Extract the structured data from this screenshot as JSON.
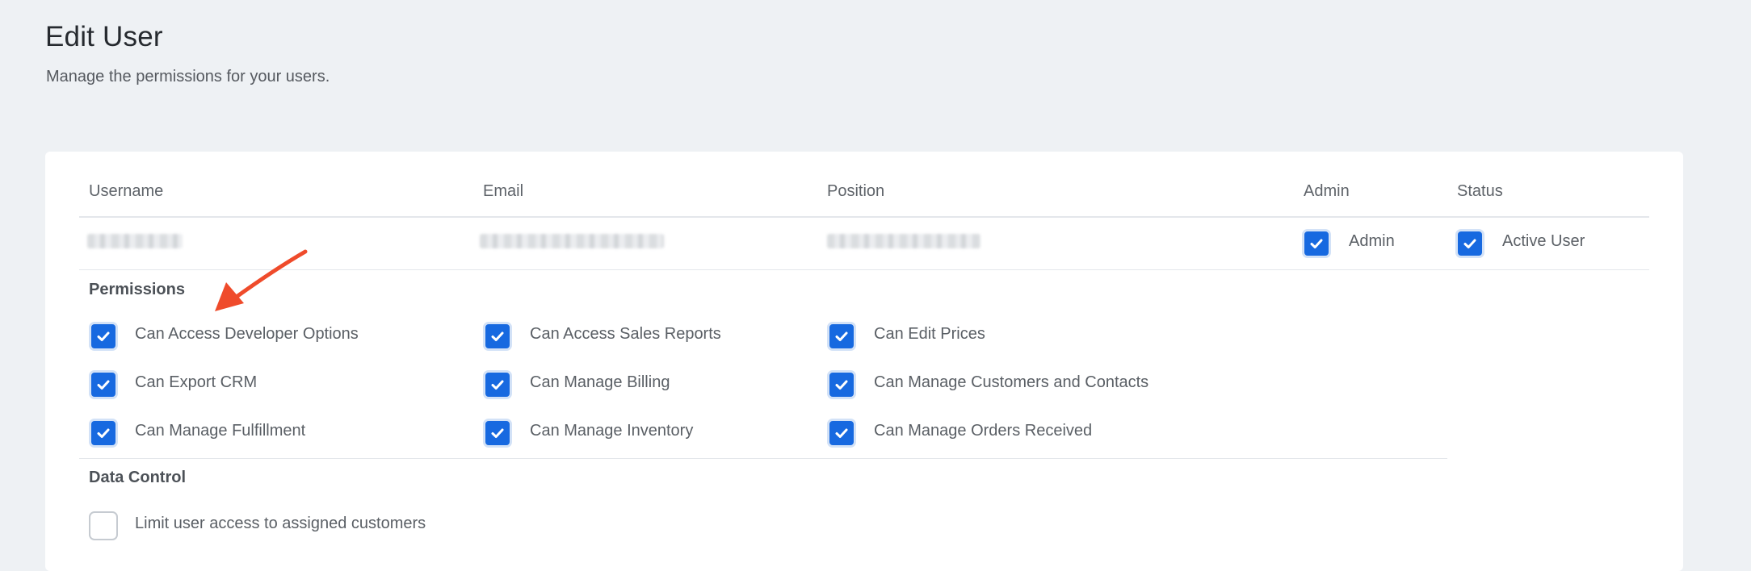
{
  "page": {
    "title": "Edit User",
    "subtitle": "Manage the permissions for your users."
  },
  "table": {
    "headers": {
      "username": "Username",
      "email": "Email",
      "position": "Position",
      "admin": "Admin",
      "status": "Status"
    },
    "row": {
      "admin_checked": true,
      "admin_label": "Admin",
      "status_checked": true,
      "status_label": "Active User"
    }
  },
  "permissions": {
    "title": "Permissions",
    "items": [
      {
        "label": "Can Access Developer Options",
        "checked": true
      },
      {
        "label": "Can Access Sales Reports",
        "checked": true
      },
      {
        "label": "Can Edit Prices",
        "checked": true
      },
      {
        "label": "Can Export CRM",
        "checked": true
      },
      {
        "label": "Can Manage Billing",
        "checked": true
      },
      {
        "label": "Can Manage Customers and Contacts",
        "checked": true
      },
      {
        "label": "Can Manage Fulfillment",
        "checked": true
      },
      {
        "label": "Can Manage Inventory",
        "checked": true
      },
      {
        "label": "Can Manage Orders Received",
        "checked": true
      }
    ]
  },
  "data_control": {
    "title": "Data Control",
    "items": [
      {
        "label": "Limit user access to assigned customers",
        "checked": false
      }
    ]
  },
  "colors": {
    "accent": "#1769e0",
    "annotation_arrow": "#ef4b2b"
  }
}
